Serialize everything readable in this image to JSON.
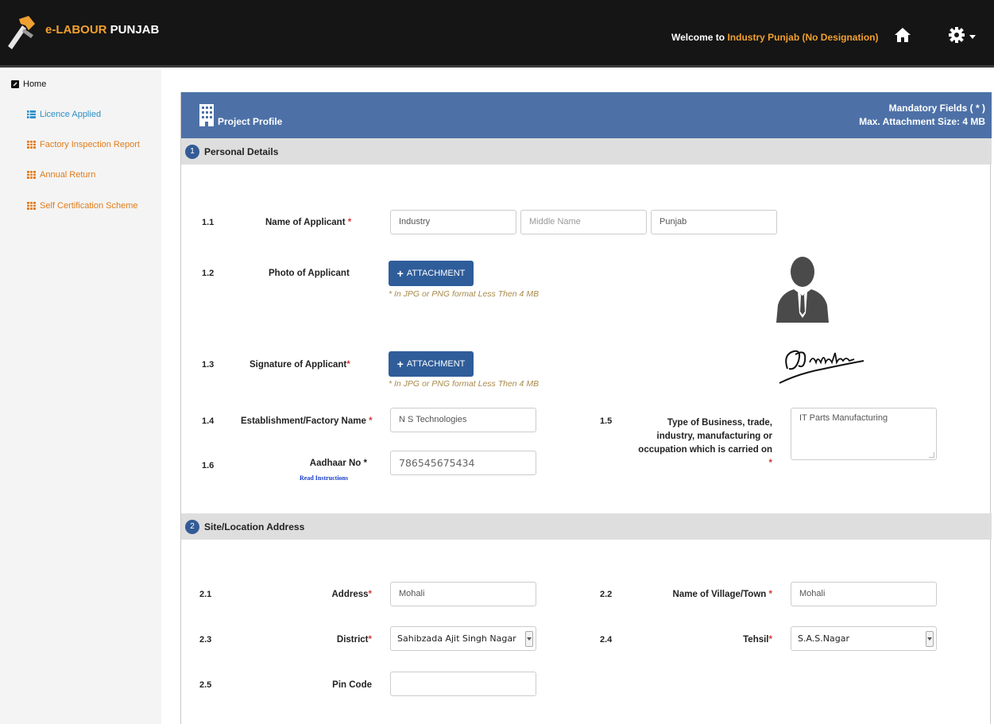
{
  "app": {
    "brand_part1": "e-LABOUR",
    "brand_part2": "PUNJAB",
    "welcome_prefix": "Welcome to ",
    "welcome_user": "Industry Punjab (No Designation)",
    "icons": [
      "hammer-logo-icon",
      "home-icon",
      "gear-icon",
      "caret-down-icon"
    ]
  },
  "sidebar": {
    "home": "Home",
    "items": [
      {
        "label": "Licence Applied",
        "color": "#2d8fc8"
      },
      {
        "label": "Factory Inspection Report",
        "color": "#e07c1a"
      },
      {
        "label": "Annual Return",
        "color": "#e07c1a"
      },
      {
        "label": "Self Certification Scheme",
        "color": "#e07c1a"
      }
    ]
  },
  "panel": {
    "title": "Project Profile",
    "mandatory_note": "Mandatory Fields ( * )",
    "attachment_note": "Max. Attachment Size: 4 MB"
  },
  "section1": {
    "number": "1",
    "title": "Personal Details",
    "fields": {
      "name": {
        "num": "1.1",
        "label": "Name of Applicant",
        "first": "Industry",
        "middle_placeholder": "Middle Name",
        "last": "Punjab"
      },
      "photo": {
        "num": "1.2",
        "label": "Photo of Applicant",
        "button": "ATTACHMENT",
        "hint": "* In JPG or PNG format Less Then 4 MB"
      },
      "signature": {
        "num": "1.3",
        "label": "Signature of Applicant",
        "button": "ATTACHMENT",
        "hint": "* In JPG or PNG format Less Then 4 MB"
      },
      "establishment": {
        "num": "1.4",
        "label": "Establishment/Factory Name",
        "value": "N S Technologies"
      },
      "business": {
        "num": "1.5",
        "label_line1": "Type of Business, trade,",
        "label_line2": "industry, manufacturing or",
        "label_line3": "occupation which is carried on",
        "value": "IT Parts Manufacturing"
      },
      "aadhaar": {
        "num": "1.6",
        "label": "Aadhaar No",
        "star": "*",
        "link": "Read Instructions",
        "value": "786545675434"
      }
    }
  },
  "section2": {
    "number": "2",
    "title": "Site/Location Address",
    "fields": {
      "address": {
        "num": "2.1",
        "label": "Address",
        "value": "Mohali"
      },
      "village": {
        "num": "2.2",
        "label": "Name of Village/Town",
        "value": "Mohali"
      },
      "district": {
        "num": "2.3",
        "label": "District",
        "value": "Sahibzada Ajit Singh Nagar"
      },
      "tehsil": {
        "num": "2.4",
        "label": "Tehsil",
        "value": "S.A.S.Nagar"
      },
      "pincode": {
        "num": "2.5",
        "label": "Pin Code",
        "value": ""
      }
    }
  },
  "colors": {
    "accent_orange": "#f0a030",
    "panel_blue": "#4d71a7",
    "button_blue": "#2f5d9a",
    "required_red": "#d9383a"
  }
}
